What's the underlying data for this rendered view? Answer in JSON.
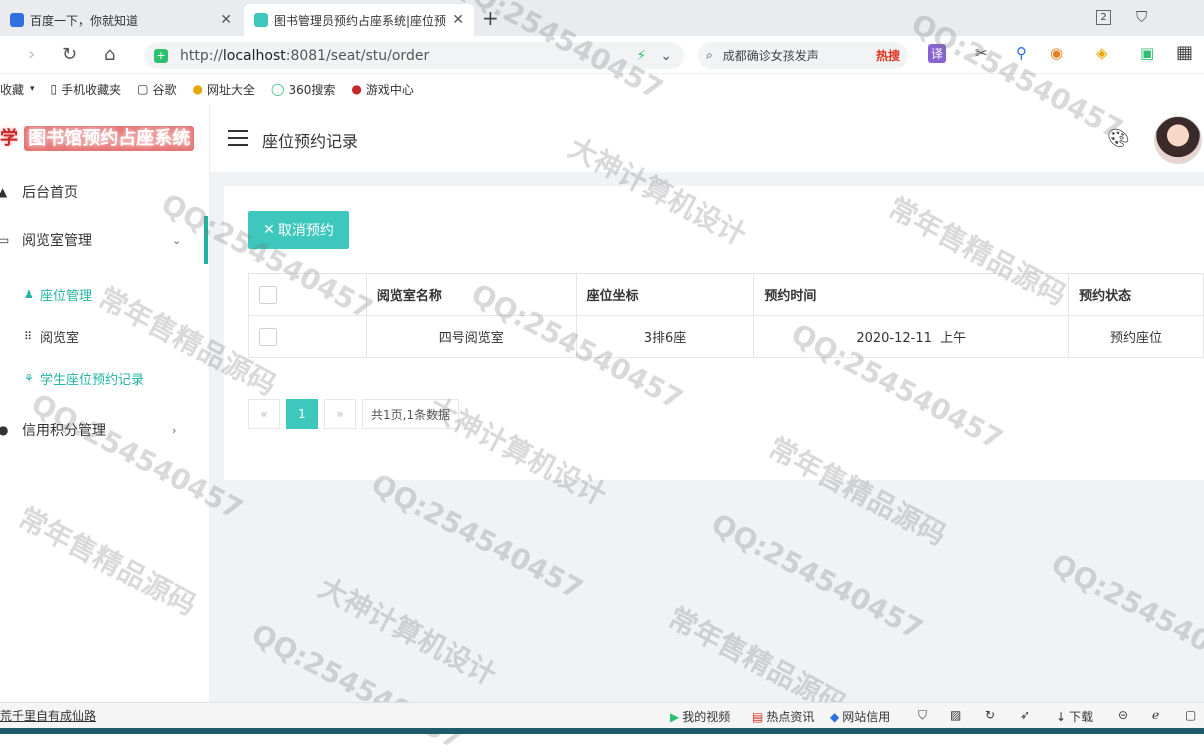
{
  "browser": {
    "tabs": [
      {
        "label": "百度一下，你就知道",
        "active": false
      },
      {
        "label": "图书管理员预约占座系统|座位预",
        "active": true
      }
    ],
    "new_tab": "+",
    "tab_count": "2",
    "url_prefix": "http://",
    "url_host": "localhost",
    "url_rest": ":8081/seat/stu/order",
    "search_text": "成都确诊女孩发声",
    "search_hot": "热搜",
    "translate_label": "译",
    "bookmarks": [
      "收藏",
      "手机收藏夹",
      "谷歌",
      "网址大全",
      "360搜索",
      "游戏中心"
    ]
  },
  "app": {
    "logo_prefix": "学",
    "logo_text": "图书馆预约占座系统",
    "page_title": "座位预约记录",
    "menu": [
      {
        "label": "后台首页"
      },
      {
        "label": "阅览室管理",
        "arrow": "⌄"
      },
      {
        "label": "信用积分管理",
        "arrow": "›"
      }
    ],
    "submenu": [
      {
        "label": "座位管理",
        "active": true
      },
      {
        "label": "阅览室",
        "active": false
      },
      {
        "label": "学生座位预约记录",
        "active": true
      }
    ],
    "cancel_button": "取消预约",
    "table": {
      "headers": [
        "阅览室名称",
        "座位坐标",
        "预约时间",
        "预约状态"
      ],
      "rows": [
        {
          "room": "四号阅览室",
          "seat": "3排6座",
          "time": "2020-12-11  上午",
          "status": "预约座位"
        }
      ]
    },
    "pager": {
      "prev": "«",
      "current": "1",
      "next": "»",
      "info": "共1页,1条数据"
    }
  },
  "statusbar": {
    "left_link": "荒千里自有成仙路",
    "items": [
      "我的视频",
      "热点资讯",
      "网站信用",
      "下载"
    ]
  },
  "watermarks": [
    "QQ:254540457",
    "大神计算机设计",
    "常年售精品源码"
  ],
  "colors": {
    "accent": "#3ec7bc",
    "logo_red": "#c62828",
    "hot_red": "#e0301e"
  }
}
